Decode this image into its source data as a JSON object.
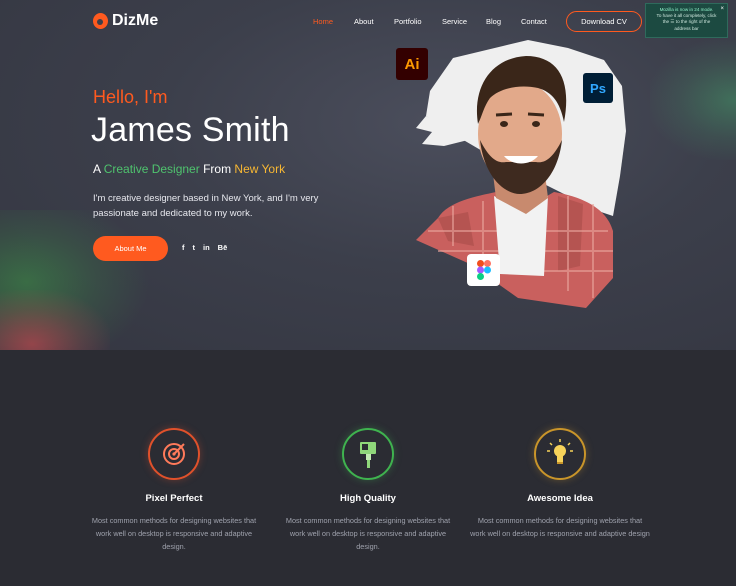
{
  "brand": {
    "name": "DizMe",
    "accent": "#ff5a1f"
  },
  "nav": {
    "items": [
      {
        "label": "Home",
        "active": true
      },
      {
        "label": "About",
        "active": false
      },
      {
        "label": "Portfolio",
        "active": false
      },
      {
        "label": "Service",
        "active": false
      },
      {
        "label": "Blog",
        "active": false
      },
      {
        "label": "Contact",
        "active": false
      }
    ],
    "cta_label": "Download CV"
  },
  "notification": {
    "title": "Mozilla is now in 24 mode.",
    "line1": "To have it all completely, click",
    "line2": "the",
    "line3": "to the right of the",
    "line4": "address bar"
  },
  "hero": {
    "greeting": "Hello, I'm",
    "name": "James Smith",
    "tagline_a": "A ",
    "tagline_role": "Creative Designer",
    "tagline_from": " From ",
    "tagline_city": "New York",
    "description": "I'm creative designer based in New York, and I'm very passionate and dedicated to my work.",
    "button_label": "About Me",
    "socials": [
      {
        "icon": "facebook-icon",
        "glyph": "f"
      },
      {
        "icon": "twitter-icon",
        "glyph": "t"
      },
      {
        "icon": "linkedin-icon",
        "glyph": "in"
      },
      {
        "icon": "behance-icon",
        "glyph": "Bē"
      }
    ],
    "badges": {
      "ai": "Ai",
      "ps": "Ps",
      "figma": "figma-icon"
    }
  },
  "services": [
    {
      "icon": "target-icon",
      "title": "Pixel Perfect",
      "description": "Most common methods for designing websites that work well on desktop is responsive and adaptive design.",
      "ring_color": "#e0512b"
    },
    {
      "icon": "paint-brush-icon",
      "title": "High Quality",
      "description": "Most common methods for designing websites that work well on desktop is responsive and adaptive design.",
      "ring_color": "#3fb34f"
    },
    {
      "icon": "lightbulb-icon",
      "title": "Awesome Idea",
      "description": "Most common methods for designing websites that work well on desktop is responsive and adaptive design",
      "ring_color": "#c9952a"
    }
  ]
}
